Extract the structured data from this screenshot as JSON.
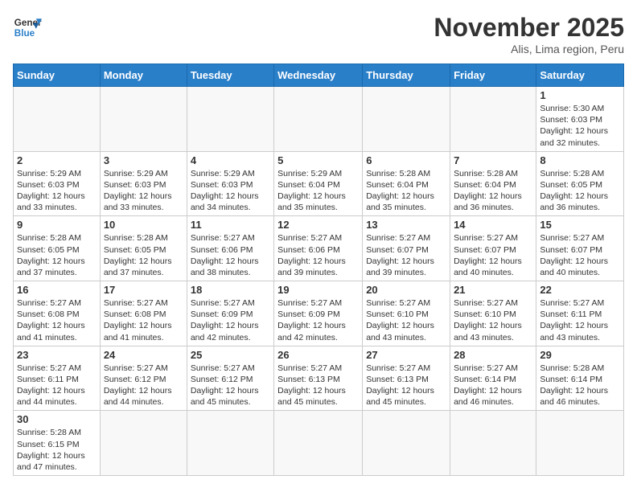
{
  "header": {
    "logo_general": "General",
    "logo_blue": "Blue",
    "month_title": "November 2025",
    "subtitle": "Alis, Lima region, Peru"
  },
  "weekdays": [
    "Sunday",
    "Monday",
    "Tuesday",
    "Wednesday",
    "Thursday",
    "Friday",
    "Saturday"
  ],
  "weeks": [
    [
      {
        "day": "",
        "info": ""
      },
      {
        "day": "",
        "info": ""
      },
      {
        "day": "",
        "info": ""
      },
      {
        "day": "",
        "info": ""
      },
      {
        "day": "",
        "info": ""
      },
      {
        "day": "",
        "info": ""
      },
      {
        "day": "1",
        "info": "Sunrise: 5:30 AM\nSunset: 6:03 PM\nDaylight: 12 hours and 32 minutes."
      }
    ],
    [
      {
        "day": "2",
        "info": "Sunrise: 5:29 AM\nSunset: 6:03 PM\nDaylight: 12 hours and 33 minutes."
      },
      {
        "day": "3",
        "info": "Sunrise: 5:29 AM\nSunset: 6:03 PM\nDaylight: 12 hours and 33 minutes."
      },
      {
        "day": "4",
        "info": "Sunrise: 5:29 AM\nSunset: 6:03 PM\nDaylight: 12 hours and 34 minutes."
      },
      {
        "day": "5",
        "info": "Sunrise: 5:29 AM\nSunset: 6:04 PM\nDaylight: 12 hours and 35 minutes."
      },
      {
        "day": "6",
        "info": "Sunrise: 5:28 AM\nSunset: 6:04 PM\nDaylight: 12 hours and 35 minutes."
      },
      {
        "day": "7",
        "info": "Sunrise: 5:28 AM\nSunset: 6:04 PM\nDaylight: 12 hours and 36 minutes."
      },
      {
        "day": "8",
        "info": "Sunrise: 5:28 AM\nSunset: 6:05 PM\nDaylight: 12 hours and 36 minutes."
      }
    ],
    [
      {
        "day": "9",
        "info": "Sunrise: 5:28 AM\nSunset: 6:05 PM\nDaylight: 12 hours and 37 minutes."
      },
      {
        "day": "10",
        "info": "Sunrise: 5:28 AM\nSunset: 6:05 PM\nDaylight: 12 hours and 37 minutes."
      },
      {
        "day": "11",
        "info": "Sunrise: 5:27 AM\nSunset: 6:06 PM\nDaylight: 12 hours and 38 minutes."
      },
      {
        "day": "12",
        "info": "Sunrise: 5:27 AM\nSunset: 6:06 PM\nDaylight: 12 hours and 39 minutes."
      },
      {
        "day": "13",
        "info": "Sunrise: 5:27 AM\nSunset: 6:07 PM\nDaylight: 12 hours and 39 minutes."
      },
      {
        "day": "14",
        "info": "Sunrise: 5:27 AM\nSunset: 6:07 PM\nDaylight: 12 hours and 40 minutes."
      },
      {
        "day": "15",
        "info": "Sunrise: 5:27 AM\nSunset: 6:07 PM\nDaylight: 12 hours and 40 minutes."
      }
    ],
    [
      {
        "day": "16",
        "info": "Sunrise: 5:27 AM\nSunset: 6:08 PM\nDaylight: 12 hours and 41 minutes."
      },
      {
        "day": "17",
        "info": "Sunrise: 5:27 AM\nSunset: 6:08 PM\nDaylight: 12 hours and 41 minutes."
      },
      {
        "day": "18",
        "info": "Sunrise: 5:27 AM\nSunset: 6:09 PM\nDaylight: 12 hours and 42 minutes."
      },
      {
        "day": "19",
        "info": "Sunrise: 5:27 AM\nSunset: 6:09 PM\nDaylight: 12 hours and 42 minutes."
      },
      {
        "day": "20",
        "info": "Sunrise: 5:27 AM\nSunset: 6:10 PM\nDaylight: 12 hours and 43 minutes."
      },
      {
        "day": "21",
        "info": "Sunrise: 5:27 AM\nSunset: 6:10 PM\nDaylight: 12 hours and 43 minutes."
      },
      {
        "day": "22",
        "info": "Sunrise: 5:27 AM\nSunset: 6:11 PM\nDaylight: 12 hours and 43 minutes."
      }
    ],
    [
      {
        "day": "23",
        "info": "Sunrise: 5:27 AM\nSunset: 6:11 PM\nDaylight: 12 hours and 44 minutes."
      },
      {
        "day": "24",
        "info": "Sunrise: 5:27 AM\nSunset: 6:12 PM\nDaylight: 12 hours and 44 minutes."
      },
      {
        "day": "25",
        "info": "Sunrise: 5:27 AM\nSunset: 6:12 PM\nDaylight: 12 hours and 45 minutes."
      },
      {
        "day": "26",
        "info": "Sunrise: 5:27 AM\nSunset: 6:13 PM\nDaylight: 12 hours and 45 minutes."
      },
      {
        "day": "27",
        "info": "Sunrise: 5:27 AM\nSunset: 6:13 PM\nDaylight: 12 hours and 45 minutes."
      },
      {
        "day": "28",
        "info": "Sunrise: 5:27 AM\nSunset: 6:14 PM\nDaylight: 12 hours and 46 minutes."
      },
      {
        "day": "29",
        "info": "Sunrise: 5:28 AM\nSunset: 6:14 PM\nDaylight: 12 hours and 46 minutes."
      }
    ],
    [
      {
        "day": "30",
        "info": "Sunrise: 5:28 AM\nSunset: 6:15 PM\nDaylight: 12 hours and 47 minutes."
      },
      {
        "day": "",
        "info": ""
      },
      {
        "day": "",
        "info": ""
      },
      {
        "day": "",
        "info": ""
      },
      {
        "day": "",
        "info": ""
      },
      {
        "day": "",
        "info": ""
      },
      {
        "day": "",
        "info": ""
      }
    ]
  ]
}
